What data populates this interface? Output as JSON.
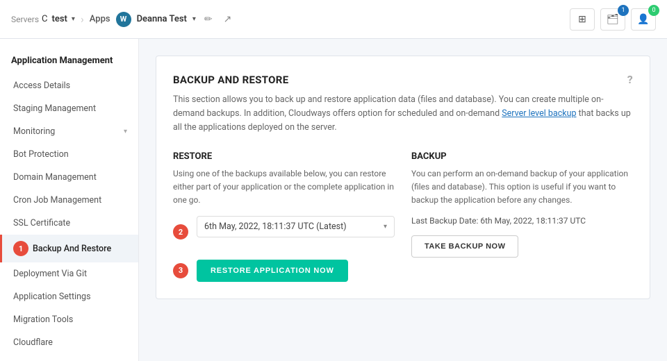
{
  "topnav": {
    "servers_label": "Servers",
    "server_name": "test",
    "separator": "›",
    "apps_label": "Apps",
    "app_name": "Deanna Test",
    "nav_icons": {
      "grid_icon": "⊞",
      "inbox_icon": "🗂",
      "inbox_count": "1",
      "user_icon": "👤",
      "user_count": "0"
    }
  },
  "sidebar": {
    "section_title": "Application Management",
    "items": [
      {
        "label": "Access Details",
        "active": false
      },
      {
        "label": "Staging Management",
        "active": false
      },
      {
        "label": "Monitoring",
        "active": false,
        "has_chevron": true
      },
      {
        "label": "Bot Protection",
        "active": false
      },
      {
        "label": "Domain Management",
        "active": false
      },
      {
        "label": "Cron Job Management",
        "active": false
      },
      {
        "label": "SSL Certificate",
        "active": false
      },
      {
        "label": "Backup And Restore",
        "active": true,
        "badge": "1"
      },
      {
        "label": "Deployment Via Git",
        "active": false
      },
      {
        "label": "Application Settings",
        "active": false
      },
      {
        "label": "Migration Tools",
        "active": false
      },
      {
        "label": "Cloudflare",
        "active": false
      }
    ]
  },
  "main": {
    "section_heading": "BACKUP AND RESTORE",
    "description": "This section allows you to back up and restore application data (files and database). You can create multiple on-demand backups. In addition, Cloudways offers option for scheduled and on-demand",
    "description_link": "Server level backup",
    "description_suffix": "that backs up all the applications deployed on the server.",
    "restore": {
      "title": "RESTORE",
      "description": "Using one of the backups available below, you can restore either part of your application or the complete application in one go.",
      "dropdown_value": "6th May, 2022, 18:11:37 UTC (Latest)",
      "dropdown_badge": "2",
      "restore_btn_label": "RESTORE APPLICATION NOW",
      "restore_btn_badge": "3"
    },
    "backup": {
      "title": "BACKUP",
      "description": "You can perform an on-demand backup of your application (files and database). This option is useful if you want to backup the application before any changes.",
      "last_backup_label": "Last Backup Date: 6th May, 2022, 18:11:37 UTC",
      "backup_btn_label": "TAKE BACKUP NOW"
    }
  }
}
